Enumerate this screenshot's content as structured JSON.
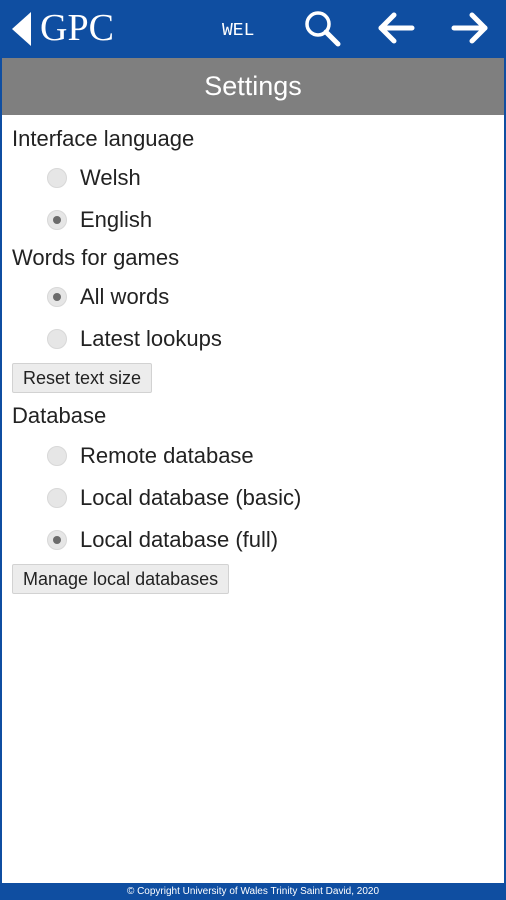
{
  "header": {
    "brand": "GPC",
    "lang_code": "WEL",
    "icons": [
      "back-triangle-icon",
      "search-icon",
      "arrow-left-icon",
      "arrow-right-icon"
    ],
    "color": "#0f4ea1"
  },
  "title": "Settings",
  "interface_language": {
    "label": "Interface language",
    "options": [
      "Welsh",
      "English"
    ],
    "selected": "English"
  },
  "words_for_games": {
    "label": "Words for games",
    "options": [
      "All words",
      "Latest lookups"
    ],
    "selected": "All words"
  },
  "reset_text_size_label": "Reset text size",
  "database": {
    "label": "Database",
    "options": [
      "Remote database",
      "Local database (basic)",
      "Local database (full)"
    ],
    "selected": "Local database (full)"
  },
  "manage_databases_label": "Manage local databases",
  "footer": {
    "copyright": "© Copyright University of Wales Trinity Saint David, 2020"
  }
}
